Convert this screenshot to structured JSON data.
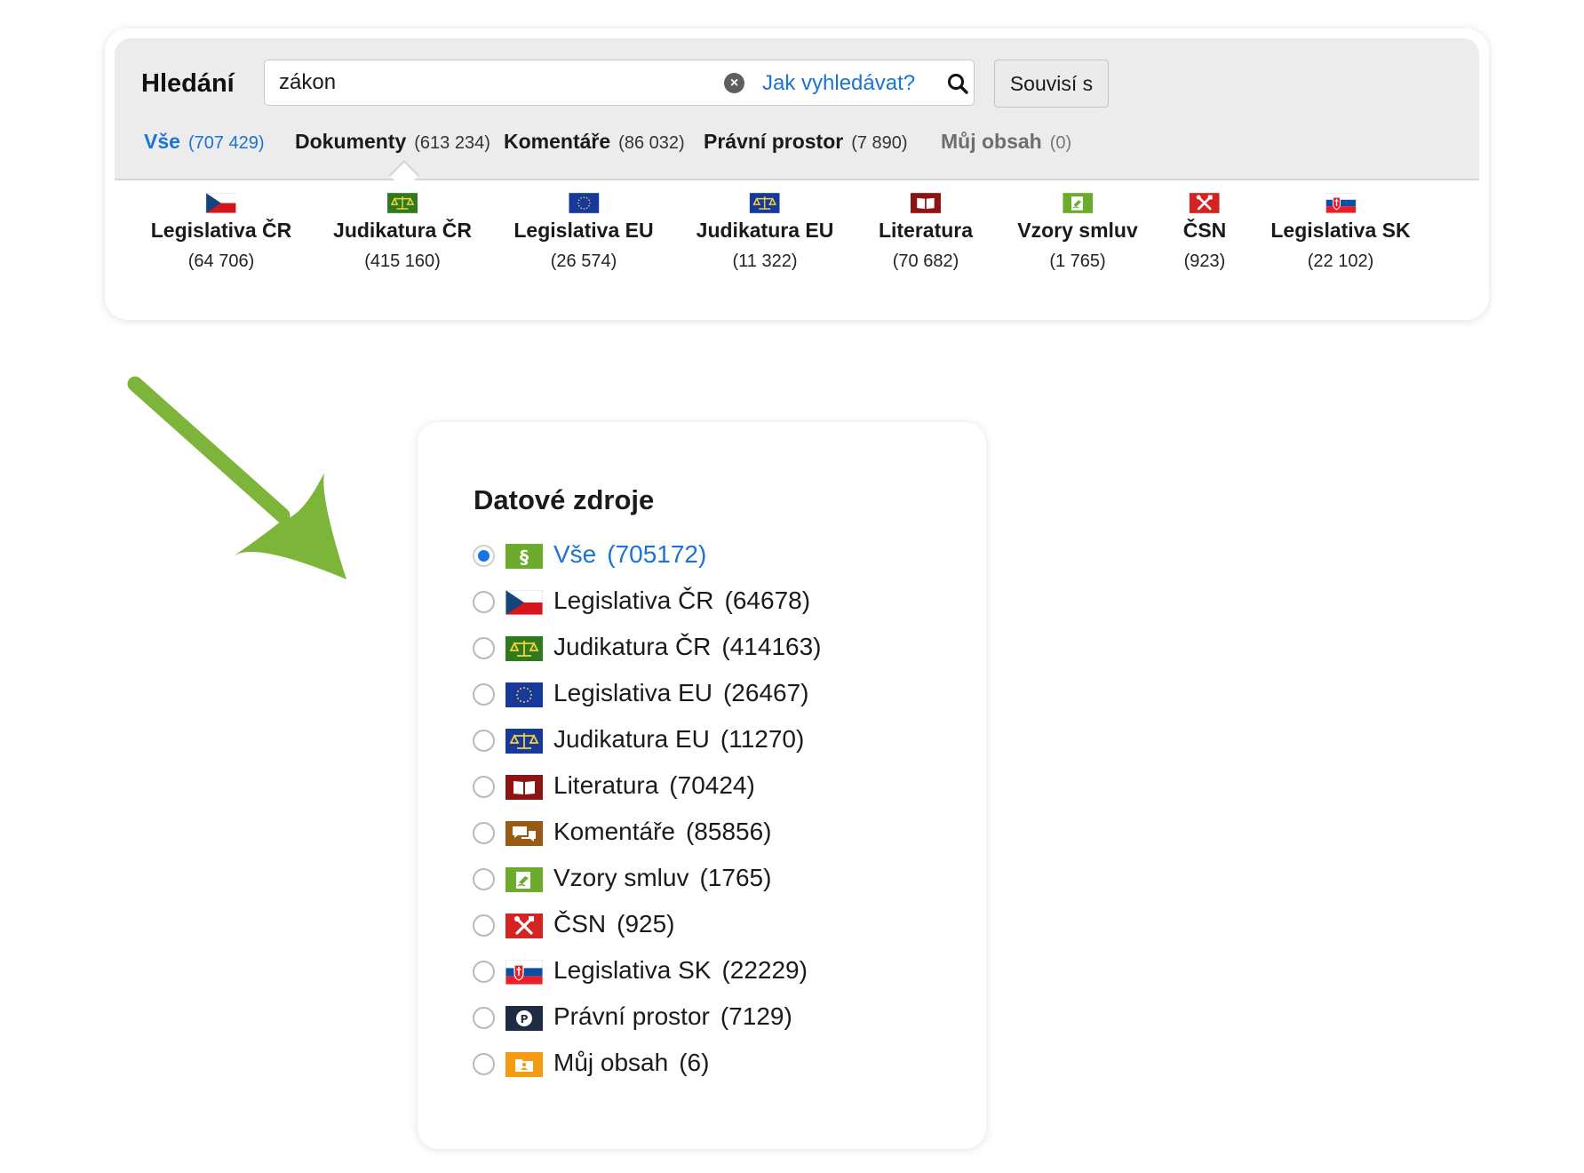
{
  "search": {
    "title": "Hledání",
    "query": "zákon",
    "help_link": "Jak vyhledávat?",
    "related_button": "Souvisí s"
  },
  "tabs": [
    {
      "label": "Vše",
      "count": "(707 429)"
    },
    {
      "label": "Dokumenty",
      "count": "(613 234)"
    },
    {
      "label": "Komentáře",
      "count": "(86 032)"
    },
    {
      "label": "Právní prostor",
      "count": "(7 890)"
    },
    {
      "label": "Můj obsah",
      "count": "(0)"
    }
  ],
  "sources": [
    {
      "label": "Legislativa ČR",
      "count": "(64 706)",
      "icon": "flag-cz-icon"
    },
    {
      "label": "Judikatura ČR",
      "count": "(415 160)",
      "icon": "scales-cz-icon"
    },
    {
      "label": "Legislativa EU",
      "count": "(26 574)",
      "icon": "flag-eu-icon"
    },
    {
      "label": "Judikatura EU",
      "count": "(11 322)",
      "icon": "scales-eu-icon"
    },
    {
      "label": "Literatura",
      "count": "(70 682)",
      "icon": "book-icon"
    },
    {
      "label": "Vzory smluv",
      "count": "(1 765)",
      "icon": "contract-icon"
    },
    {
      "label": "ČSN",
      "count": "(923)",
      "icon": "tools-icon"
    },
    {
      "label": "Legislativa SK",
      "count": "(22 102)",
      "icon": "flag-sk-icon"
    }
  ],
  "data_sources": {
    "title": "Datové zdroje",
    "items": [
      {
        "label": "Vše",
        "count": "(705172)",
        "icon": "paragraph-icon",
        "selected": true
      },
      {
        "label": "Legislativa ČR",
        "count": "(64678)",
        "icon": "flag-cz-icon"
      },
      {
        "label": "Judikatura ČR",
        "count": "(414163)",
        "icon": "scales-cz-icon"
      },
      {
        "label": "Legislativa EU",
        "count": "(26467)",
        "icon": "flag-eu-icon"
      },
      {
        "label": "Judikatura EU",
        "count": "(11270)",
        "icon": "scales-eu-icon"
      },
      {
        "label": "Literatura",
        "count": "(70424)",
        "icon": "book-icon"
      },
      {
        "label": "Komentáře",
        "count": "(85856)",
        "icon": "comments-icon"
      },
      {
        "label": "Vzory smluv",
        "count": "(1765)",
        "icon": "contract-icon"
      },
      {
        "label": "ČSN",
        "count": "(925)",
        "icon": "tools-icon"
      },
      {
        "label": "Legislativa SK",
        "count": "(22229)",
        "icon": "flag-sk-icon"
      },
      {
        "label": "Právní prostor",
        "count": "(7129)",
        "icon": "pp-logo-icon"
      },
      {
        "label": "Můj obsah",
        "count": "(6)",
        "icon": "folder-user-icon"
      }
    ]
  },
  "colors": {
    "link_blue": "#1a73d6",
    "radio_blue": "#1a73e8",
    "arrow_green": "#7db43a",
    "header_gray": "#ececec"
  }
}
